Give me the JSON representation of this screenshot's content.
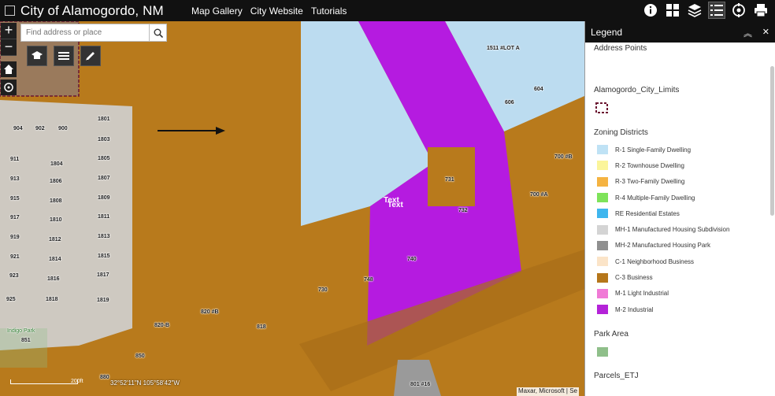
{
  "app": {
    "title": "City of Alamogordo, NM"
  },
  "nav": [
    "Map Gallery",
    "City Website",
    "Tutorials"
  ],
  "toolbar": {
    "icons": [
      "info-icon",
      "basemap-gallery-icon",
      "layers-icon",
      "legend-icon",
      "parcel-tools-icon",
      "print-icon"
    ],
    "active": "legend-icon"
  },
  "search": {
    "placeholder": "Find address or place",
    "value": ""
  },
  "map": {
    "zoom_in": "+",
    "zoom_out": "−",
    "parcel_labels": [
      "904",
      "902",
      "900",
      "1801",
      "1803",
      "911",
      "1804",
      "1805",
      "913",
      "1806",
      "1807",
      "915",
      "1808",
      "1809",
      "917",
      "1810",
      "1811",
      "919",
      "1812",
      "1813",
      "921",
      "1814",
      "1815",
      "923",
      "1816",
      "1817",
      "925",
      "1818",
      "1819",
      "1511 #LOT A",
      "604",
      "606",
      "700 #B",
      "731",
      "700 #A",
      "732",
      "740",
      "748",
      "730",
      "820 #B",
      "820-B",
      "818",
      "850",
      "880",
      "801 #16"
    ],
    "park_label": "Indigo Park",
    "park_number": "851",
    "text_markers": [
      "Text",
      "Text"
    ],
    "scale_label": "200ft",
    "coordinates": "32°52'11\"N 105°58'42\"W",
    "attribution": "Maxar, Microsoft | Se"
  },
  "legend": {
    "title": "Legend",
    "layers": {
      "address_points": "Address Points",
      "city_limits": "Alamogordo_City_Limits",
      "zoning": "Zoning Districts",
      "park_area": "Park Area",
      "parcels": "Parcels_ETJ"
    },
    "zoning_items": [
      {
        "label": "R-1 Single-Family Dwelling",
        "color": "#bfe2f5"
      },
      {
        "label": "R-2 Townhouse Dwelling",
        "color": "#fbf59a"
      },
      {
        "label": "R-3 Two-Family Dwelling",
        "color": "#f5b341"
      },
      {
        "label": "R-4 Multiple-Family Dwelling",
        "color": "#7ee35a"
      },
      {
        "label": "RE Residential Estates",
        "color": "#3fb6ee"
      },
      {
        "label": "MH-1 Manufactured Housing Subdivision",
        "color": "#d4d4d4"
      },
      {
        "label": "MH-2 Manufactured Housing Park",
        "color": "#8f8f8f"
      },
      {
        "label": "C-1 Neighborhood Business",
        "color": "#fbe4c8"
      },
      {
        "label": "C-3 Business",
        "color": "#b5761a"
      },
      {
        "label": "M-1 Light Industrial",
        "color": "#f07ad6"
      },
      {
        "label": "M-2 Industrial",
        "color": "#b423d8"
      }
    ],
    "park_color": "#8fbf8a",
    "city_limits_color": "#6b1530"
  },
  "colors": {
    "map_commercial": "#b87a1c",
    "map_residential": "#bcdcf0",
    "map_industrial": "#b51be0",
    "map_mh": "#cfcfcf"
  }
}
